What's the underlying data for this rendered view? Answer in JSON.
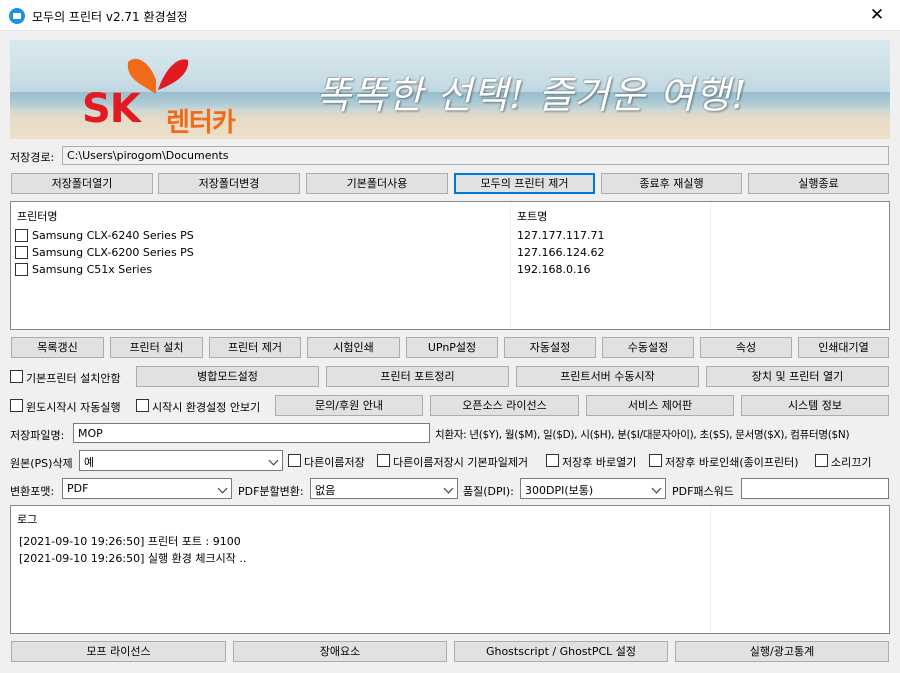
{
  "window": {
    "title": "모두의 프린터 v2.71 환경설정",
    "close": "✕"
  },
  "banner": {
    "brand": "SK",
    "brand_sub": "렌터카",
    "slogan": "똑똑한 선택! 즐거운 여행!",
    "colors": {
      "brand_red": "#e21b23",
      "brand_orange": "#f06a1a"
    }
  },
  "save_path": {
    "label": "저장경로:",
    "value": "C:\\Users\\pirogom\\Documents"
  },
  "toolbar1": [
    "저장폴더열기",
    "저장폴더변경",
    "기본폴더사용",
    "모두의 프린터 제거",
    "종료후 재실행",
    "실행종료"
  ],
  "printer_list": {
    "headers": {
      "name": "프린터명",
      "port": "포트명"
    },
    "rows": [
      {
        "name": "Samsung CLX-6240 Series PS",
        "port": "127.177.117.71",
        "checked": false
      },
      {
        "name": "Samsung CLX-6200 Series PS",
        "port": "127.166.124.62",
        "checked": false
      },
      {
        "name": "Samsung C51x Series",
        "port": "192.168.0.16",
        "checked": false
      }
    ]
  },
  "toolbar2": [
    "목록갱신",
    "프린터 설치",
    "프린터 제거",
    "시험인쇄",
    "UPnP설정",
    "자동설정",
    "수동설정",
    "속성",
    "인쇄대기열"
  ],
  "row3": {
    "check_default_printer": "기본프린터 설치안함",
    "buttons": [
      "병합모드설정",
      "프린터 포트정리",
      "프린트서버 수동시작",
      "장치 및 프린터 열기"
    ]
  },
  "row4": {
    "check_autostart": "윈도시작시 자동실행",
    "check_no_settings": "시작시 환경설정 안보기",
    "buttons": [
      "문의/후원 안내",
      "오픈소스 라이선스",
      "서비스 제어판",
      "시스템 정보"
    ]
  },
  "filename": {
    "label": "저장파일명:",
    "value": "MOP",
    "hint": "치환자: 년($Y), 월($M), 일($D), 시($H), 분($I/대문자아이), 초($S), 문서명($X), 컴퓨터명($N)"
  },
  "original_delete": {
    "label": "원본(PS)삭제",
    "value": "예",
    "checks": [
      "다른이름저장",
      "다른이름저장시 기본파일제거",
      "저장후 바로열기",
      "저장후 바로인쇄(종이프린터)",
      "소리끄기"
    ]
  },
  "convert": {
    "format_label": "변환포맷:",
    "format_value": "PDF",
    "split_label": "PDF분할변환:",
    "split_value": "없음",
    "quality_label": "품질(DPI):",
    "quality_value": "300DPI(보통)",
    "password_label": "PDF패스워드",
    "password_value": ""
  },
  "log": {
    "header": "로그",
    "lines": [
      "[2021-09-10 19:26:50] 프린터 포트 : 9100",
      "[2021-09-10 19:26:50] 실행 환경 체크시작 .."
    ]
  },
  "bottom_buttons": [
    "모프 라이선스",
    "장애요소",
    "Ghostscript / GhostPCL 설정",
    "실행/광고통계"
  ]
}
